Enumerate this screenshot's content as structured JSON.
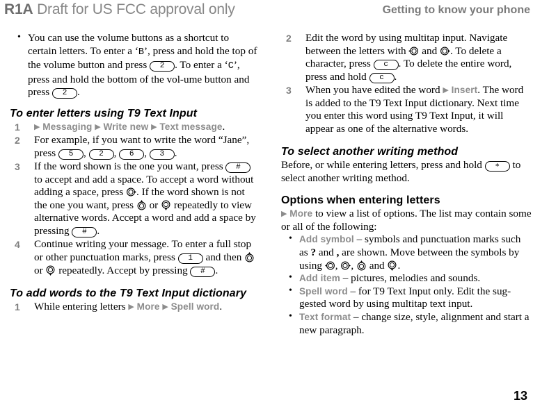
{
  "header": {
    "left_bold": "R1A",
    "left_rest": "Draft for US FCC approval only",
    "right": "Getting to know your phone"
  },
  "page_number": "13",
  "left_column": {
    "intro_bullet": {
      "t1": "You can use the volume buttons as a shortcut to certain letters. To enter a ‘",
      "letter_b": "B",
      "t2": "’, press and hold the top of the volume button and press ",
      "key1": "2",
      "t3": ". To enter a ‘",
      "letter_c": "C",
      "t4": "’, press and hold the bottom of the vol-ume button and press ",
      "key2": "2",
      "t5": "."
    },
    "section1": {
      "heading": "To enter letters using T9 Text Input",
      "steps": [
        {
          "num": "1",
          "arrow1": "▶",
          "ui1": "Messaging",
          "arrow2": "▶",
          "ui2": "Write new",
          "arrow3": "▶",
          "ui3": "Text message",
          "tail": "."
        },
        {
          "num": "2",
          "t1": "For example, if you want to write the word “Jane”, press ",
          "keys": [
            "5",
            "2",
            "6",
            "3"
          ],
          "tail": "."
        },
        {
          "num": "3",
          "t1": "If the word shown is the one you want, press ",
          "key1": "#",
          "t2": " to accept and add a space. To accept a word without adding a space, press ",
          "icon1": "nav-right-icon",
          "t3": ". If the word shown is not the one you want, press ",
          "icon2": "nav-up-icon",
          "t4": " or ",
          "icon3": "nav-down-icon",
          "t5": " repeatedly to view alternative words. Accept a word and add a space by pressing ",
          "key2": "#",
          "t6": "."
        },
        {
          "num": "4",
          "t1": "Continue writing your message. To enter a full stop or other punctuation marks, press ",
          "key1": "1",
          "t2": " and then ",
          "icon1": "nav-up-icon",
          "t3": " or ",
          "icon2": "nav-down-icon",
          "t4": " repeatedly. Accept by pressing ",
          "key2": "#",
          "t5": "."
        }
      ]
    },
    "section2": {
      "heading": "To add words to the T9 Text Input dictionary",
      "steps": [
        {
          "num": "1",
          "t1": "While entering letters ",
          "arrow1": "▶",
          "ui1": "More",
          "arrow2": "▶",
          "ui2": "Spell word",
          "tail": "."
        }
      ]
    }
  },
  "right_column": {
    "steps": [
      {
        "num": "2",
        "t1": "Edit the word by using multitap input. Navigate between the letters with ",
        "icon1": "nav-left-icon",
        "t2": " and ",
        "icon2": "nav-right-icon",
        "t3": ". To delete a character, press ",
        "key1": "c",
        "t4": ". To delete the entire word, press and hold ",
        "key2": "c",
        "t5": "."
      },
      {
        "num": "3",
        "t1": "When you have edited the word ",
        "arrow1": "▶",
        "ui1": "Insert",
        "t2": ". The word is added to the T9 Text Input dictionary. Next time you enter this word using T9 Text Input, it will appear as one of the alternative words."
      }
    ],
    "section3": {
      "heading": "To select another writing method",
      "t1": "Before, or while entering letters, press and hold ",
      "key1": "∗",
      "t2": " to select another writing method."
    },
    "section4": {
      "heading": "Options when entering letters",
      "intro_arrow": "▶",
      "intro_ui": "More",
      "intro_text": " to view a list of options. The list may contain some or all of the following:",
      "bullets": [
        {
          "term": "Add symbol",
          "dash": " – ",
          "t1": "symbols and punctuation marks such as ",
          "sym1": "?",
          "t2": " and ",
          "sym2": ",",
          "t3": " are shown. Move between the symbols by using ",
          "icon1": "nav-left-icon",
          "t4": ", ",
          "icon2": "nav-right-icon",
          "t5": ", ",
          "icon3": "nav-up-icon",
          "t6": " and ",
          "icon4": "nav-down-icon",
          "t7": "."
        },
        {
          "term": "Add item",
          "dash": " – ",
          "t1": "pictures, melodies and sounds."
        },
        {
          "term": "Spell word",
          "dash": " – ",
          "t1": "for T9 Text Input only. Edit the sug-gested word by using multitap text input."
        },
        {
          "term": "Text format",
          "dash": " – ",
          "t1": "change size, style, alignment and start a new paragraph."
        }
      ]
    }
  },
  "colors": {
    "header_grey": "#878787",
    "ui_term_grey": "#8c8c8c",
    "step_num_grey": "#808080"
  }
}
